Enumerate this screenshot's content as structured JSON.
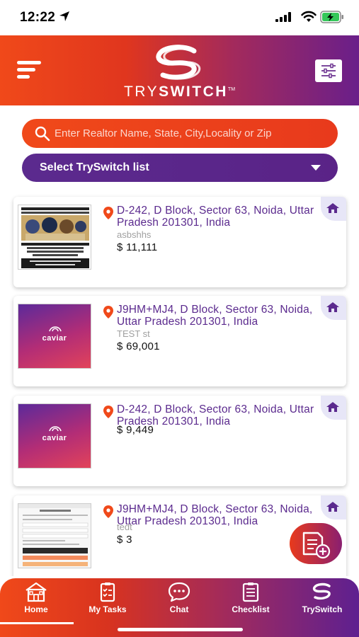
{
  "status_bar": {
    "time": "12:22"
  },
  "header": {
    "brand_light": "TRY",
    "brand_bold": "SWITCH",
    "trademark": "TM"
  },
  "search": {
    "placeholder": "Enter Realtor Name, State, City,Locality or Zip"
  },
  "select_list": {
    "label": "Select TrySwitch list"
  },
  "listings": [
    {
      "address": "D-242, D Block, Sector 63, Noida, Uttar Pradesh 201301, India",
      "subtitle": "asbshhs",
      "price": "$ 11,111",
      "thumb": "poster"
    },
    {
      "address": "J9HM+MJ4, D Block, Sector 63, Noida, Uttar Pradesh 201301, India",
      "subtitle": "TEST st",
      "price": "$ 69,001",
      "thumb": "caviar",
      "thumb_text": "caviar"
    },
    {
      "address": "D-242, D Block, Sector 63, Noida, Uttar Pradesh 201301, India",
      "subtitle": "",
      "price": "$ 9,449",
      "thumb": "caviar",
      "thumb_text": "caviar"
    },
    {
      "address": "J9HM+MJ4, D Block, Sector 63, Noida, Uttar Pradesh 201301, India",
      "subtitle": "tedt",
      "price": "$ 3",
      "thumb": "document"
    }
  ],
  "bottom_nav": [
    {
      "label": "Home",
      "icon": "home-icon"
    },
    {
      "label": "My Tasks",
      "icon": "tasks-icon"
    },
    {
      "label": "Chat",
      "icon": "chat-icon"
    },
    {
      "label": "Checklist",
      "icon": "checklist-icon"
    },
    {
      "label": "TrySwitch",
      "icon": "tryswitch-logo-icon"
    }
  ],
  "colors": {
    "orange": "#f0491a",
    "purple": "#5b2a8e",
    "badge_bg": "#e7e6f7"
  }
}
